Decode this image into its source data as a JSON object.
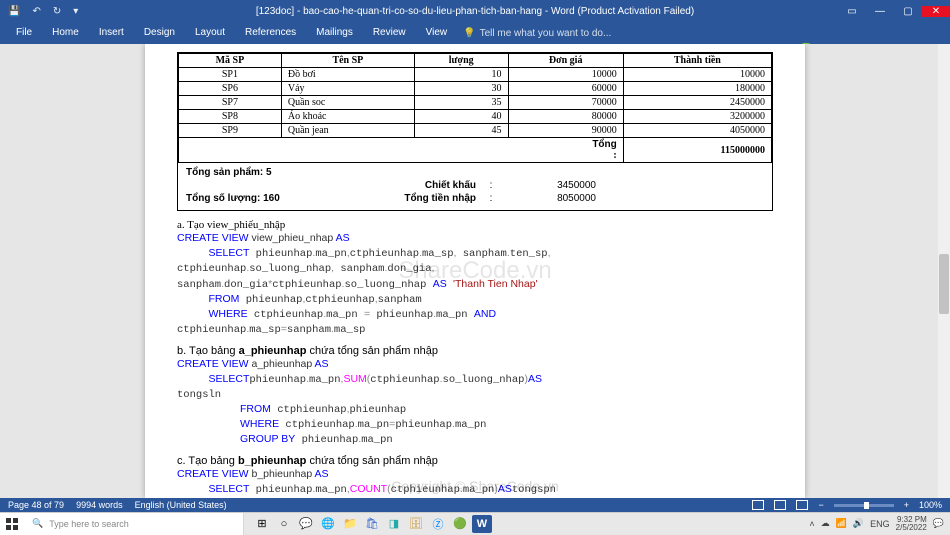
{
  "window": {
    "title": "[123doc] - bao-cao-he-quan-tri-co-so-du-lieu-phan-tich-ban-hang - Word (Product Activation Failed)"
  },
  "ribbon": {
    "tabs": [
      "File",
      "Home",
      "Insert",
      "Design",
      "Layout",
      "References",
      "Mailings",
      "Review",
      "View"
    ],
    "tellme": "Tell me what you want to do..."
  },
  "table": {
    "headers": [
      "Mã SP",
      "Tên SP",
      "lượng",
      "Đơn giá",
      "Thành tiền"
    ],
    "rows": [
      {
        "c": [
          "SP1",
          "Đồ bơi",
          "10",
          "10000",
          "10000"
        ]
      },
      {
        "c": [
          "SP6",
          "Váy",
          "30",
          "60000",
          "180000"
        ]
      },
      {
        "c": [
          "SP7",
          "Quần soc",
          "35",
          "70000",
          "2450000"
        ]
      },
      {
        "c": [
          "SP8",
          "Áo khoác",
          "40",
          "80000",
          "3200000"
        ]
      },
      {
        "c": [
          "SP9",
          "Quần jean",
          "45",
          "90000",
          "4050000"
        ]
      }
    ],
    "tong_label": "Tổng",
    "tong_value": "115000000",
    "tong_sp_label": "Tổng sản phẩm:  5",
    "tong_sl_label": "Tổng số lượng:  160",
    "chiet_khau_label": "Chiết khấu",
    "chiet_khau_val": "3450000",
    "tong_tien_label": "Tổng tiền nhập",
    "tong_tien_val": "8050000"
  },
  "body": {
    "sec_a": "a.  Tạo view_phiếu_nhập",
    "code_a_1": "CREATE VIEW",
    "code_a_2": " view_phieu_nhap ",
    "code_a_3": "AS",
    "code_a_4": "SELECT",
    "code_a_5": " phieunhap",
    "code_a_6": "ma_pn",
    "code_a_7": "ctphieunhap",
    "code_a_8": "ma_sp",
    "code_a_9": "sanpham",
    "code_a_10": "ten_sp",
    "code_a_11": "so_luong_nhap",
    "code_a_12": "don_gia",
    "code_a_13": "don_gia",
    "code_a_14": "so_luong_nhap",
    "code_a_15": "'Thanh Tien Nhap'",
    "code_a_16": "FROM",
    "code_a_17": "WHERE",
    "code_a_18": "AND",
    "sec_b": "b.  Tạo bảng ",
    "sec_b_bold": "a_phieunhap",
    "sec_b_tail": " chứa tổng sản phẩm nhập",
    "code_b_1": "CREATE VIEW",
    "code_b_2": " a_phieunhap ",
    "code_b_3": "AS",
    "code_b_4": "SELECT",
    "code_b_5": "SUM",
    "code_b_6": "tongsln",
    "code_b_7": "GROUP BY",
    "sec_c": "c.  Tạo bảng ",
    "sec_c_bold": "b_phieunhap",
    "sec_c_tail": " chứa tổng sản phẩm nhập",
    "code_c_1": "CREATE VIEW",
    "code_c_2": " b_phieunhap ",
    "code_c_3": "AS",
    "code_c_4": "SELECT",
    "code_c_5": "COUNT",
    "code_c_6": "tongspn"
  },
  "watermark": "ShareCode.vn",
  "watermark2": "Copyright © ShareCode.vn",
  "logo": {
    "brand": "SHARE",
    "code": "CODE",
    "tld": ".vn"
  },
  "status": {
    "page": "Page 48 of 79",
    "words": "9994 words",
    "lang": "English (United States)",
    "zoom": "100%"
  },
  "taskbar": {
    "search": "Type here to search",
    "time": "9:32 PM",
    "date": "2/5/2022",
    "lang": "ENG"
  }
}
